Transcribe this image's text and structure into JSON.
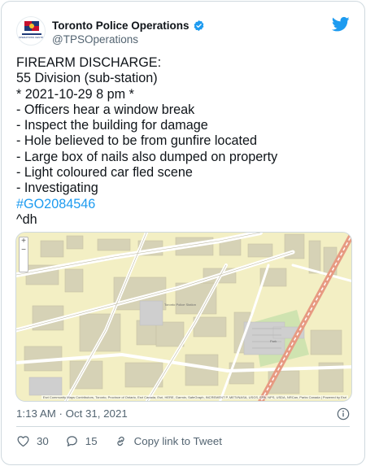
{
  "tweet": {
    "display_name": "Toronto Police Operations",
    "handle": "@TPSOperations",
    "avatar_text": "OPERATIONS CENTRE",
    "lines": [
      "FIREARM DISCHARGE:",
      "55 Division (sub-station)",
      "* 2021-10-29 8 pm *",
      "- Officers hear a window break",
      "- Inspect the building for damage",
      "- Hole believed to be from gunfire located",
      "- Large box of nails also dumped on property",
      "- Light coloured car fled scene",
      "- Investigating"
    ],
    "hashtag": "#GO2084546",
    "signature": "^dh",
    "timestamp": "1:13 AM · Oct 31, 2021"
  },
  "map": {
    "attribution": "Esri Community Maps Contributors, Toronto, Province of Ontario, Esri Canada, Esri, HERE, Garmin, SafeGraph, INCREMENT P, METI/NASA, USGS, EPA, NPS, USDA, NRCan, Parks Canada | Powered by Esri",
    "zoom_in": "+",
    "zoom_out": "−",
    "labels": {
      "center": "Toronto Police Station",
      "park": "Park"
    }
  },
  "actions": {
    "likes": "30",
    "replies": "15",
    "copy_link": "Copy link to Tweet"
  },
  "colors": {
    "accent": "#1d9bf0",
    "text": "#0f1419",
    "muted": "#536471",
    "map_land": "#f3efc4",
    "map_building": "#d6d2b6",
    "map_park": "#cfe3b0",
    "map_rail": "#e79a82"
  },
  "icons": [
    "verified-badge-icon",
    "twitter-bird-icon",
    "info-icon",
    "heart-icon",
    "reply-icon",
    "link-icon"
  ]
}
